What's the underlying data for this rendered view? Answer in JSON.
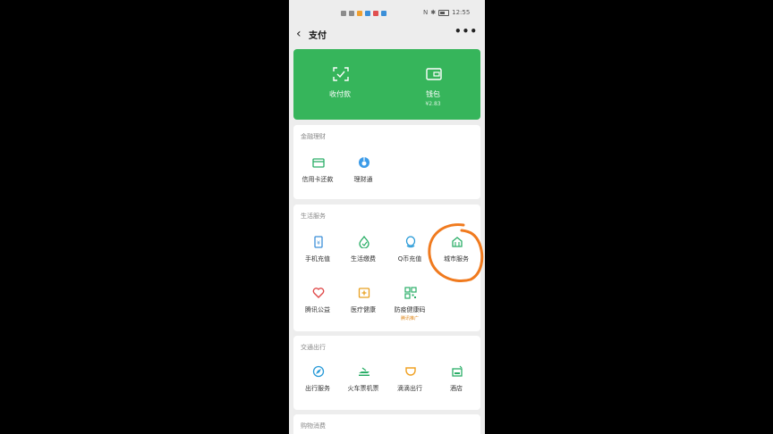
{
  "status_bar": {
    "right_text": "12:55",
    "sim_text": "N"
  },
  "nav": {
    "title": "支付",
    "more": "•••"
  },
  "green_card": {
    "items": [
      {
        "label": "收付款",
        "icon": "scan-pay-icon"
      },
      {
        "label": "钱包",
        "sub": "¥2.83",
        "icon": "wallet-icon"
      }
    ]
  },
  "finance": {
    "title": "金融理财",
    "items": [
      {
        "label": "信用卡还款",
        "icon": "credit-card-icon"
      },
      {
        "label": "理财通",
        "icon": "licaitong-icon"
      }
    ]
  },
  "life": {
    "title": "生活服务",
    "items": [
      {
        "label": "手机充值",
        "icon": "phone-topup-icon"
      },
      {
        "label": "生活缴费",
        "icon": "utility-payment-icon"
      },
      {
        "label": "Q币充值",
        "icon": "qcoin-icon"
      },
      {
        "label": "城市服务",
        "icon": "city-service-icon"
      },
      {
        "label": "腾讯公益",
        "icon": "charity-icon"
      },
      {
        "label": "医疗健康",
        "icon": "medical-icon"
      },
      {
        "label": "防疫健康码",
        "sub": "腾讯推广",
        "icon": "health-code-icon"
      }
    ]
  },
  "transport": {
    "title": "交通出行",
    "items": [
      {
        "label": "出行服务",
        "icon": "travel-service-icon"
      },
      {
        "label": "火车票机票",
        "icon": "train-ticket-icon"
      },
      {
        "label": "滴滴出行",
        "icon": "didi-icon"
      },
      {
        "label": "酒店",
        "icon": "hotel-icon"
      }
    ]
  },
  "shopping": {
    "title": "购物消费"
  },
  "colors": {
    "green": "#36b55b",
    "annotation": "#f07a1e"
  }
}
